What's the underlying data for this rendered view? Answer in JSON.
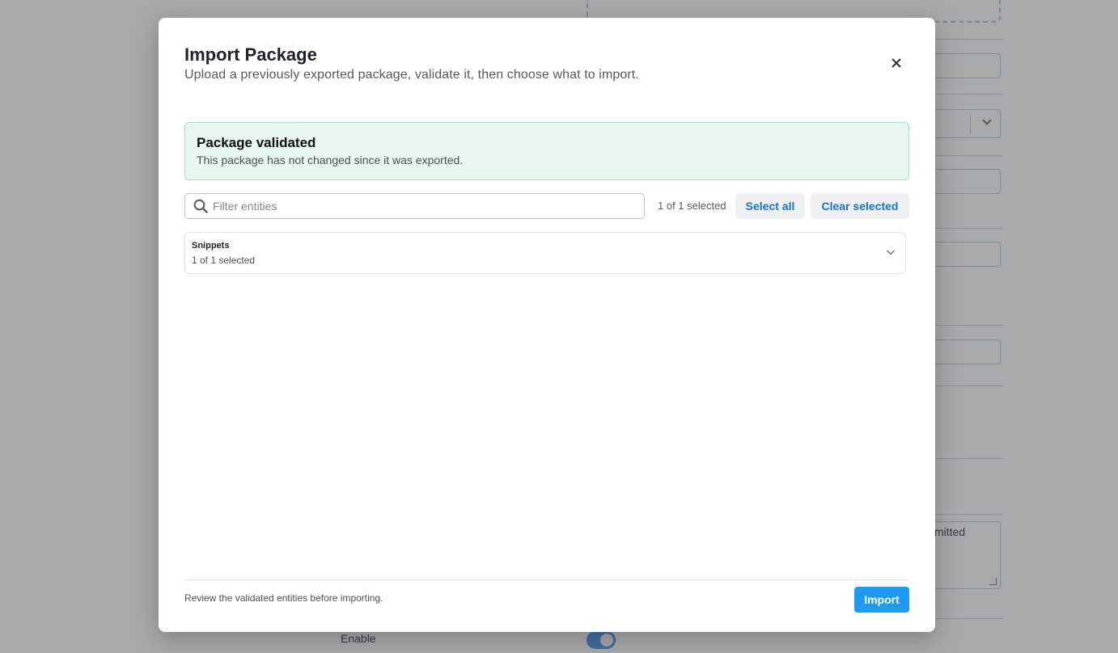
{
  "background": {
    "textarea_fragment": "mitted",
    "enable_label": "Enable",
    "enable_toggle": true
  },
  "modal": {
    "title": "Import Package",
    "subtitle": "Upload a previously exported package, validate it, then choose what to import.",
    "close_icon": "close-icon"
  },
  "alert": {
    "title": "Package validated",
    "text": "This package has not changed since it was exported.",
    "color": "#e7f6ef"
  },
  "filter": {
    "placeholder": "Filter entities",
    "value": "",
    "icon": "search-icon"
  },
  "selection": {
    "count_text": "1 of 1 selected",
    "select_all_label": "Select all",
    "clear_selected_label": "Clear selected"
  },
  "groups": [
    {
      "title": "Snippets",
      "count_text": "1 of 1 selected",
      "icon": "chevron-down-icon"
    }
  ],
  "footer": {
    "note": "Review the validated entities before importing.",
    "import_label": "Import",
    "accent": "#1e9bf0"
  }
}
